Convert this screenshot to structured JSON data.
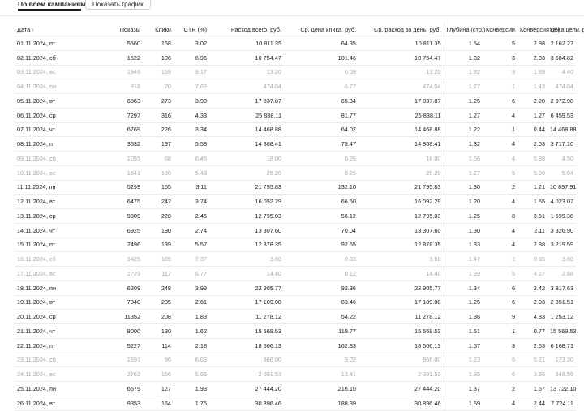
{
  "header": {
    "campaigns_label": "По всем кампаниям",
    "chart_button": "Показать график"
  },
  "table": {
    "columns": [
      "Дата",
      "Показы",
      "Клики",
      "CTR (%)",
      "Расход всего, руб.",
      "Ср. цена клика, руб.",
      "Ср. расход за день, руб.",
      "Глубина (стр.)",
      "Конверсии",
      "Конверсия (%)",
      "Цена цели, руб."
    ],
    "sort_indicator": "↑",
    "rows": [
      {
        "weekend": false,
        "cells": [
          "01.11.2024, пт",
          "5560",
          "168",
          "3.02",
          "10 811.35",
          "64.35",
          "10 811.35",
          "1.54",
          "5",
          "2.98",
          "2 162.27"
        ]
      },
      {
        "weekend": false,
        "cells": [
          "02.11.2024, сб",
          "1522",
          "106",
          "6.96",
          "10 754.47",
          "101.46",
          "10 754.47",
          "1.32",
          "3",
          "2.83",
          "3 584.82"
        ]
      },
      {
        "weekend": true,
        "cells": [
          "03.11.2024, вс",
          "1946",
          "159",
          "8.17",
          "13.20",
          "0.08",
          "13.20",
          "1.32",
          "3",
          "1.89",
          "4.40"
        ]
      },
      {
        "weekend": true,
        "cells": [
          "04.11.2024, пн",
          "918",
          "70",
          "7.63",
          "474.04",
          "6.77",
          "474.04",
          "1.27",
          "1",
          "1.43",
          "474.04"
        ]
      },
      {
        "weekend": false,
        "cells": [
          "05.11.2024, вт",
          "6863",
          "273",
          "3.98",
          "17 837.87",
          "65.34",
          "17 837.87",
          "1.25",
          "6",
          "2.20",
          "2 972.98"
        ]
      },
      {
        "weekend": false,
        "cells": [
          "06.11.2024, ср",
          "7297",
          "316",
          "4.33",
          "25 838.11",
          "81.77",
          "25 838.11",
          "1.27",
          "4",
          "1.27",
          "6 459.53"
        ]
      },
      {
        "weekend": false,
        "cells": [
          "07.11.2024, чт",
          "6769",
          "226",
          "3.34",
          "14 468.88",
          "64.02",
          "14 468.88",
          "1.22",
          "1",
          "0.44",
          "14 468.88"
        ]
      },
      {
        "weekend": false,
        "cells": [
          "08.11.2024, пт",
          "3532",
          "197",
          "5.58",
          "14 868.41",
          "75.47",
          "14 868.41",
          "1.32",
          "4",
          "2.03",
          "3 717.10"
        ]
      },
      {
        "weekend": true,
        "cells": [
          "09.11.2024, сб",
          "1055",
          "68",
          "6.45",
          "18.00",
          "0.26",
          "18.00",
          "1.66",
          "4",
          "5.88",
          "4.50"
        ]
      },
      {
        "weekend": true,
        "cells": [
          "10.11.2024, вс",
          "1841",
          "100",
          "5.43",
          "25.20",
          "0.25",
          "25.20",
          "1.27",
          "5",
          "5.00",
          "5.04"
        ]
      },
      {
        "weekend": false,
        "cells": [
          "11.11.2024, пн",
          "5299",
          "165",
          "3.11",
          "21 795.83",
          "132.10",
          "21 795.83",
          "1.30",
          "2",
          "1.21",
          "10 897.91"
        ]
      },
      {
        "weekend": false,
        "cells": [
          "12.11.2024, вт",
          "6475",
          "242",
          "3.74",
          "16 092.29",
          "66.50",
          "16 092.29",
          "1.20",
          "4",
          "1.65",
          "4 023.07"
        ]
      },
      {
        "weekend": false,
        "cells": [
          "13.11.2024, ср",
          "9309",
          "228",
          "2.45",
          "12 795.03",
          "56.12",
          "12 795.03",
          "1.25",
          "8",
          "3.51",
          "1 599.38"
        ]
      },
      {
        "weekend": false,
        "cells": [
          "14.11.2024, чт",
          "6925",
          "190",
          "2.74",
          "13 307.60",
          "70.04",
          "13 307.60",
          "1.30",
          "4",
          "2.11",
          "3 326.90"
        ]
      },
      {
        "weekend": false,
        "cells": [
          "15.11.2024, пт",
          "2496",
          "139",
          "5.57",
          "12 878.35",
          "92.65",
          "12 878.35",
          "1.33",
          "4",
          "2.88",
          "3 219.59"
        ]
      },
      {
        "weekend": true,
        "cells": [
          "16.11.2024, сб",
          "1425",
          "105",
          "7.37",
          "3.60",
          "0.03",
          "3.60",
          "1.47",
          "1",
          "0.95",
          "3.60"
        ]
      },
      {
        "weekend": true,
        "cells": [
          "17.11.2024, вс",
          "1729",
          "117",
          "6.77",
          "14.40",
          "0.12",
          "14.40",
          "1.39",
          "5",
          "4.27",
          "2.88"
        ]
      },
      {
        "weekend": false,
        "cells": [
          "18.11.2024, пн",
          "6209",
          "248",
          "3.99",
          "22 905.77",
          "92.36",
          "22 905.77",
          "1.34",
          "6",
          "2.42",
          "3 817.63"
        ]
      },
      {
        "weekend": false,
        "cells": [
          "19.11.2024, вт",
          "7840",
          "205",
          "2.61",
          "17 109.08",
          "83.46",
          "17 109.08",
          "1.25",
          "6",
          "2.93",
          "2 851.51"
        ]
      },
      {
        "weekend": false,
        "cells": [
          "20.11.2024, ср",
          "11352",
          "208",
          "1.83",
          "11 278.12",
          "54.22",
          "11 278.12",
          "1.36",
          "9",
          "4.33",
          "1 253.12"
        ]
      },
      {
        "weekend": false,
        "cells": [
          "21.11.2024, чт",
          "8000",
          "130",
          "1.62",
          "15 569.53",
          "119.77",
          "15 569.53",
          "1.61",
          "1",
          "0.77",
          "15 569.53"
        ]
      },
      {
        "weekend": false,
        "cells": [
          "22.11.2024, пт",
          "5227",
          "114",
          "2.18",
          "18 506.13",
          "162.33",
          "18 506.13",
          "1.57",
          "3",
          "2.63",
          "6 168.71"
        ]
      },
      {
        "weekend": true,
        "cells": [
          "23.11.2024, сб",
          "1591",
          "96",
          "6.03",
          "866.00",
          "9.02",
          "866.00",
          "1.23",
          "5",
          "5.21",
          "173.20"
        ]
      },
      {
        "weekend": true,
        "cells": [
          "24.11.2024, вс",
          "2762",
          "156",
          "5.65",
          "2 091.53",
          "13.41",
          "2 091.53",
          "1.35",
          "6",
          "3.85",
          "348.59"
        ]
      },
      {
        "weekend": false,
        "cells": [
          "25.11.2024, пн",
          "6579",
          "127",
          "1.93",
          "27 444.20",
          "216.10",
          "27 444.20",
          "1.37",
          "2",
          "1.57",
          "13 722.10"
        ]
      },
      {
        "weekend": false,
        "cells": [
          "26.11.2024, вт",
          "9353",
          "164",
          "1.75",
          "30 896.46",
          "188.39",
          "30 896.46",
          "1.59",
          "4",
          "2.44",
          "7 724.11"
        ]
      }
    ]
  }
}
